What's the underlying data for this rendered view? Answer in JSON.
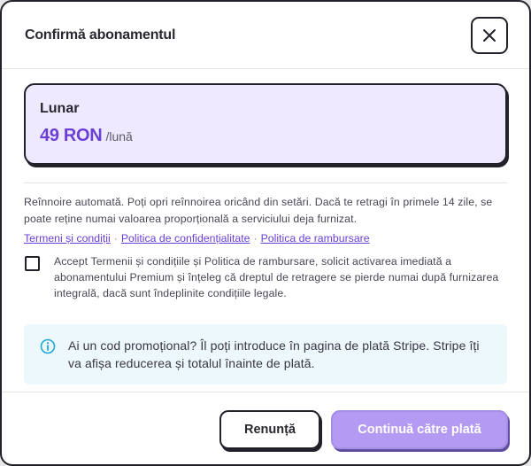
{
  "dialog": {
    "title": "Confirmă abonamentul",
    "close_icon": "close-icon"
  },
  "plan": {
    "name": "Lunar",
    "price": "49 RON",
    "period": "/lună",
    "accent_color": "#6a3fd6",
    "card_bg": "#efe9ff"
  },
  "renewal_notice": "Reînnoire automată. Poți opri reînnoirea oricând din setări. Dacă te retragi în primele 14 zile, se poate reține numai valoarea proporțională a serviciului deja furnizat.",
  "links": {
    "terms": "Termeni și condiții",
    "privacy": "Politica de confidențialitate",
    "refund": "Politica de rambursare",
    "separator": "·"
  },
  "consent": {
    "checked": false,
    "text": "Accept Termenii și condițiile și Politica de rambursare, solicit activarea imediată a abonamentului Premium și înțeleg că dreptul de retragere se pierde numai după furnizarea integrală, dacă sunt îndeplinite condițiile legale."
  },
  "info": {
    "icon": "info-icon",
    "text": "Ai un cod promoțional? Îl poți introduce în pagina de plată Stripe. Stripe îți va afișa reducerea și totalul înainte de plată.",
    "bg_color": "#edf8fd",
    "icon_color": "#1ea7d6"
  },
  "actions": {
    "cancel_label": "Renunță",
    "continue_label": "Continuă către plată",
    "continue_color": "#b49af3"
  }
}
